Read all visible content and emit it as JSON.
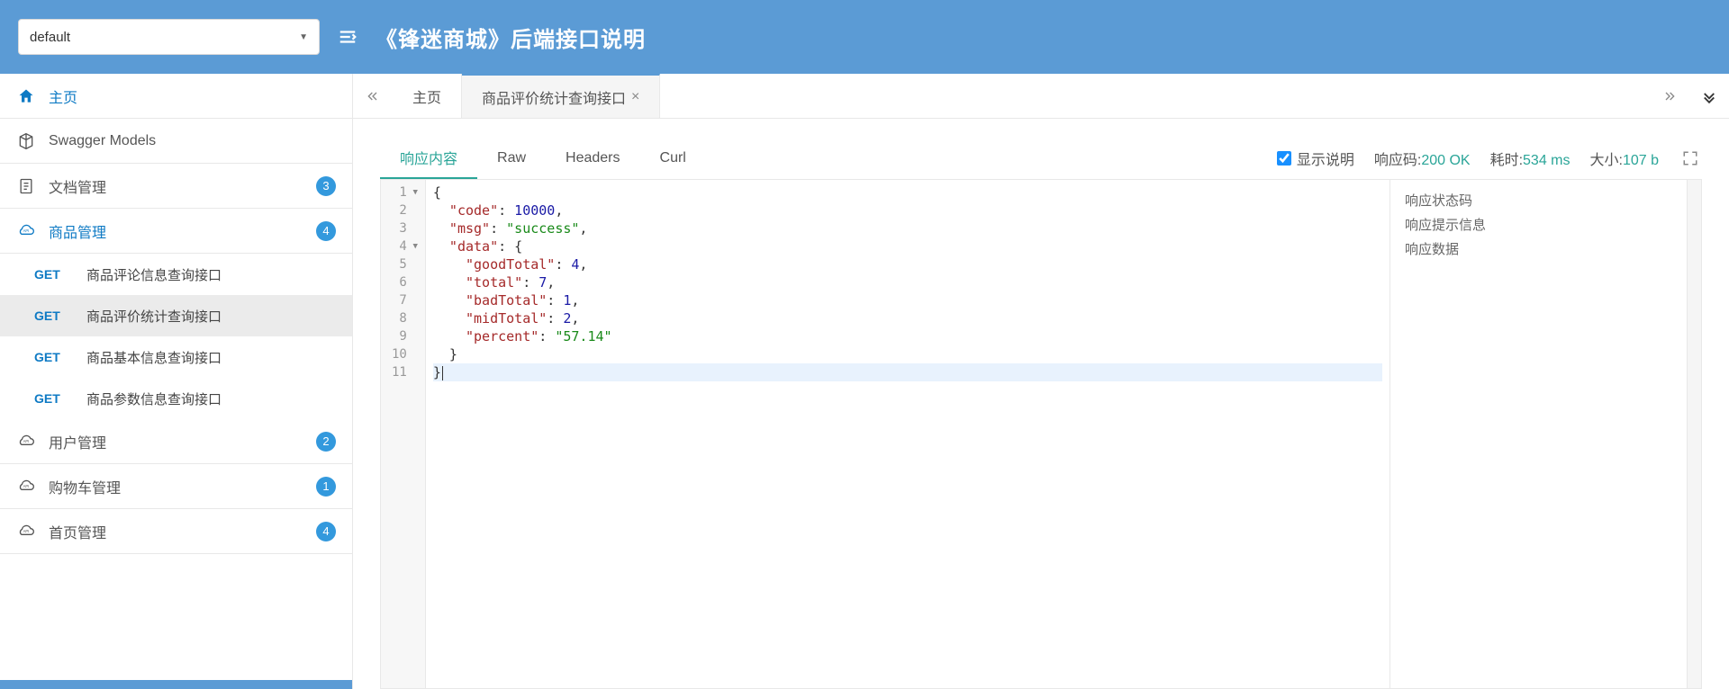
{
  "header": {
    "select_value": "default",
    "title": "《锋迷商城》后端接口说明"
  },
  "sidebar": {
    "home": "主页",
    "items": [
      {
        "label": "Swagger Models"
      },
      {
        "label": "文档管理",
        "badge": "3"
      },
      {
        "label": "商品管理",
        "badge": "4",
        "active": true
      },
      {
        "label": "用户管理",
        "badge": "2"
      },
      {
        "label": "购物车管理",
        "badge": "1"
      },
      {
        "label": "首页管理",
        "badge": "4"
      }
    ],
    "subitems": [
      {
        "method": "GET",
        "label": "商品评论信息查询接口"
      },
      {
        "method": "GET",
        "label": "商品评价统计查询接口",
        "selected": true
      },
      {
        "method": "GET",
        "label": "商品基本信息查询接口"
      },
      {
        "method": "GET",
        "label": "商品参数信息查询接口"
      }
    ]
  },
  "tabs": {
    "items": [
      {
        "label": "主页"
      },
      {
        "label": "商品评价统计查询接口",
        "active": true,
        "closable": true
      }
    ]
  },
  "response": {
    "tabs": [
      {
        "label": "响应内容",
        "active": true
      },
      {
        "label": "Raw"
      },
      {
        "label": "Headers"
      },
      {
        "label": "Curl"
      }
    ],
    "show_desc_label": "显示说明",
    "show_desc_checked": true,
    "status_label": "响应码:",
    "status_value": "200 OK",
    "time_label": "耗时:",
    "time_value": "534 ms",
    "size_label": "大小:",
    "size_value": "107 b",
    "descriptions": [
      "响应状态码",
      "响应提示信息",
      "响应数据"
    ],
    "code_lines": [
      [
        {
          "t": "punct",
          "v": "{"
        }
      ],
      [
        {
          "t": "indent",
          "v": "  "
        },
        {
          "t": "key",
          "v": "\"code\""
        },
        {
          "t": "punct",
          "v": ": "
        },
        {
          "t": "num",
          "v": "10000"
        },
        {
          "t": "punct",
          "v": ","
        }
      ],
      [
        {
          "t": "indent",
          "v": "  "
        },
        {
          "t": "key",
          "v": "\"msg\""
        },
        {
          "t": "punct",
          "v": ": "
        },
        {
          "t": "str",
          "v": "\"success\""
        },
        {
          "t": "punct",
          "v": ","
        }
      ],
      [
        {
          "t": "indent",
          "v": "  "
        },
        {
          "t": "key",
          "v": "\"data\""
        },
        {
          "t": "punct",
          "v": ": {"
        }
      ],
      [
        {
          "t": "indent",
          "v": "    "
        },
        {
          "t": "key",
          "v": "\"goodTotal\""
        },
        {
          "t": "punct",
          "v": ": "
        },
        {
          "t": "num",
          "v": "4"
        },
        {
          "t": "punct",
          "v": ","
        }
      ],
      [
        {
          "t": "indent",
          "v": "    "
        },
        {
          "t": "key",
          "v": "\"total\""
        },
        {
          "t": "punct",
          "v": ": "
        },
        {
          "t": "num",
          "v": "7"
        },
        {
          "t": "punct",
          "v": ","
        }
      ],
      [
        {
          "t": "indent",
          "v": "    "
        },
        {
          "t": "key",
          "v": "\"badTotal\""
        },
        {
          "t": "punct",
          "v": ": "
        },
        {
          "t": "num",
          "v": "1"
        },
        {
          "t": "punct",
          "v": ","
        }
      ],
      [
        {
          "t": "indent",
          "v": "    "
        },
        {
          "t": "key",
          "v": "\"midTotal\""
        },
        {
          "t": "punct",
          "v": ": "
        },
        {
          "t": "num",
          "v": "2"
        },
        {
          "t": "punct",
          "v": ","
        }
      ],
      [
        {
          "t": "indent",
          "v": "    "
        },
        {
          "t": "key",
          "v": "\"percent\""
        },
        {
          "t": "punct",
          "v": ": "
        },
        {
          "t": "str",
          "v": "\"57.14\""
        }
      ],
      [
        {
          "t": "indent",
          "v": "  "
        },
        {
          "t": "punct",
          "v": "}"
        }
      ],
      [
        {
          "t": "punct",
          "v": "}"
        }
      ]
    ],
    "line_folds": [
      1,
      0,
      0,
      1,
      0,
      0,
      0,
      0,
      0,
      0,
      0
    ]
  }
}
